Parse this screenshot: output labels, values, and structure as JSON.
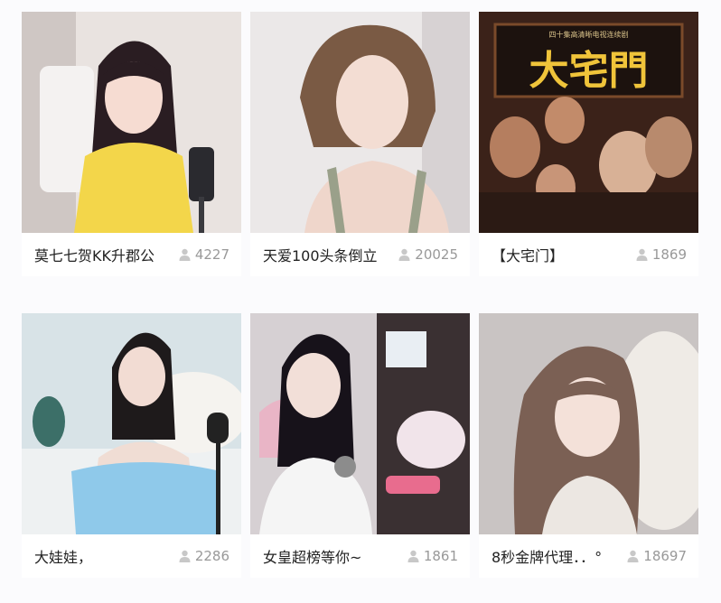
{
  "rooms": [
    {
      "title": "莫七七贺KK升郡公",
      "viewers": "4227",
      "thumb_bg": "#e9e3e0",
      "thumb_accent": "#f3d64a",
      "avatar_icon": "streamer-thumbnail"
    },
    {
      "title": "天爱100头条倒立",
      "viewers": "20025",
      "thumb_bg": "#e7e4e4",
      "thumb_accent": "#9aa08a",
      "avatar_icon": "streamer-thumbnail"
    },
    {
      "title": "【大宅门】",
      "viewers": "1869",
      "thumb_bg": "#4a2d22",
      "thumb_accent": "#c2332a",
      "avatar_icon": "tv-poster-thumbnail"
    },
    {
      "title": "大娃娃，",
      "viewers": "2286",
      "thumb_bg": "#d6e2e6",
      "thumb_accent": "#8fc9ea",
      "avatar_icon": "streamer-thumbnail"
    },
    {
      "title": "女皇超榜等你~",
      "viewers": "1861",
      "thumb_bg": "#d8d3d6",
      "thumb_accent": "#f2f2f2",
      "avatar_icon": "streamer-thumbnail"
    },
    {
      "title": "8秒金牌代理．．°",
      "viewers": "18697",
      "thumb_bg": "#c9c4c3",
      "thumb_accent": "#ece7e2",
      "avatar_icon": "streamer-thumbnail"
    }
  ],
  "poster_text": "大宅門",
  "poster_subtitle": "四十集高清晰电视连续剧"
}
